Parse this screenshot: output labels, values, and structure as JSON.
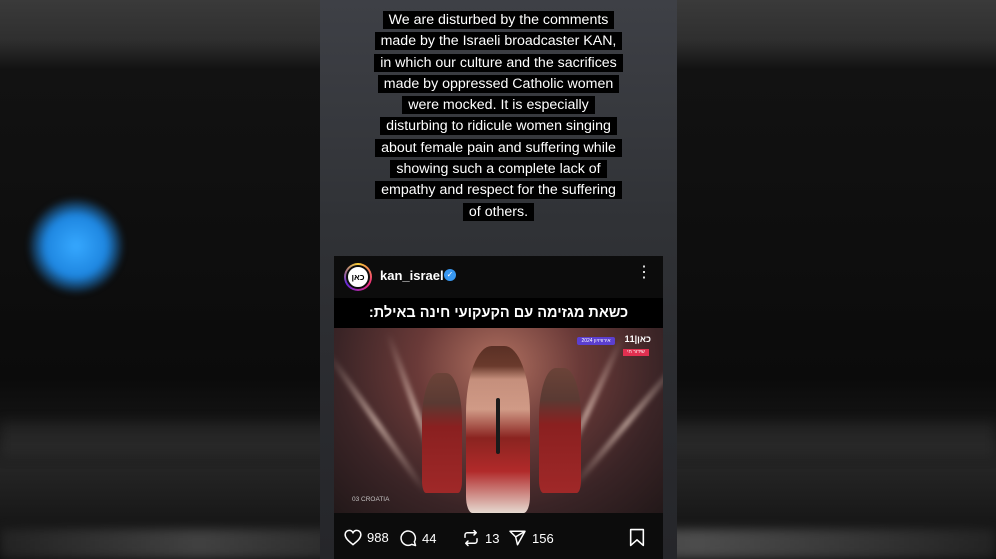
{
  "story": {
    "caption_lines": [
      "We are disturbed by the comments",
      "made by the Israeli broadcaster KAN,",
      "in which our culture and the sacrifices",
      "made by oppressed Catholic women",
      "were mocked. It is especially",
      "disturbing to ridicule women singing",
      "about female pain and suffering while",
      "showing such a complete lack of",
      "empathy and respect for the suffering",
      "of others."
    ]
  },
  "post": {
    "avatar_text": "כאן",
    "username": "kan_israel",
    "verified_icon": "check",
    "overlay_text": "כשאת מגזימה עם הקעקועי חינה באילת:",
    "stage_logo": "כאן|11",
    "stage_pill": "אירוויזיון 2024",
    "stage_sub": "שידור חי",
    "country_tag": "03 CROATIA",
    "stats": {
      "likes": "988",
      "comments": "44",
      "reposts": "13",
      "shares": "156"
    }
  },
  "colors": {
    "accent_blue": "#3897f0",
    "caption_bg": "#000000"
  }
}
